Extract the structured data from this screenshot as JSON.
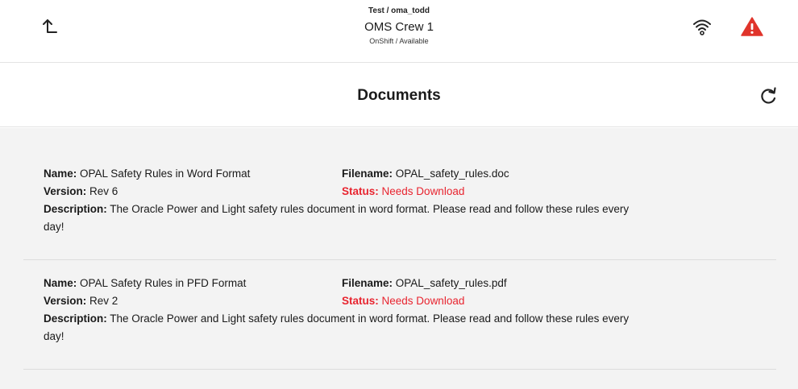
{
  "header": {
    "context": "Test / oma_todd",
    "crew": "OMS Crew 1",
    "shift_status": "OnShift / Available"
  },
  "page": {
    "title": "Documents"
  },
  "labels": {
    "name": "Name:",
    "filename": "Filename:",
    "version": "Version:",
    "status": "Status:",
    "description": "Description:"
  },
  "documents": [
    {
      "name": "OPAL Safety Rules in Word Format",
      "filename": "OPAL_safety_rules.doc",
      "version": "Rev 6",
      "status": "Needs Download",
      "description": "The Oracle Power and Light safety rules document in word format. Please read and follow these rules every day!"
    },
    {
      "name": "OPAL Safety Rules in PFD Format",
      "filename": "OPAL_safety_rules.pdf",
      "version": "Rev 2",
      "status": "Needs Download",
      "description": "The Oracle Power and Light safety rules document in word format. Please read and follow these rules every day!"
    }
  ],
  "icons": {
    "back": "upload-arrow-icon",
    "wifi": "wifi-icon",
    "alert": "warning-icon",
    "refresh": "refresh-icon"
  },
  "colors": {
    "alert": "#e0342b",
    "status": "#e8242f",
    "content_bg": "#f3f3f3"
  }
}
